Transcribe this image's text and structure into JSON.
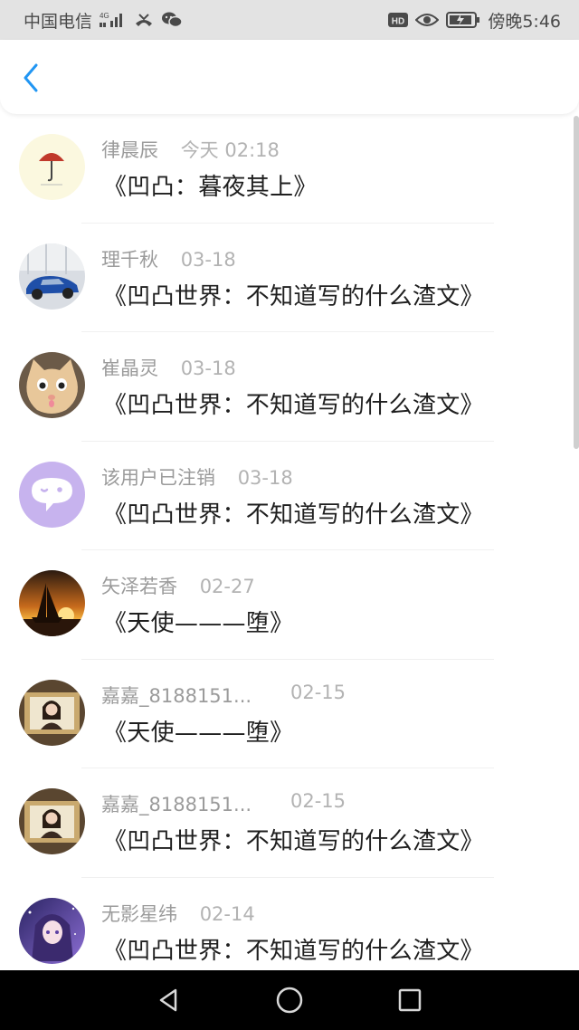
{
  "status_bar": {
    "carrier": "中国电信",
    "signal_label": "4G",
    "hd_label": "HD",
    "time": "傍晚5:46"
  },
  "header": {
    "back_icon": "chevron-left-icon"
  },
  "list": [
    {
      "name": "律晨辰",
      "time": "今天 02:18",
      "title": "《凹凸：暮夜其上》",
      "avatar": "avatar-umbrella"
    },
    {
      "name": "理千秋",
      "time": "03-18",
      "title": "《凹凸世界：不知道写的什么渣文》",
      "avatar": "avatar-car"
    },
    {
      "name": "崔晶灵",
      "time": "03-18",
      "title": "《凹凸世界：不知道写的什么渣文》",
      "avatar": "avatar-cat"
    },
    {
      "name": "该用户已注销",
      "time": "03-18",
      "title": "《凹凸世界：不知道写的什么渣文》",
      "avatar": "avatar-deleted"
    },
    {
      "name": "矢泽若香",
      "time": "02-27",
      "title": "《天使———堕》",
      "avatar": "avatar-sunset"
    },
    {
      "name": "嘉嘉_8188151...",
      "time": "02-15",
      "title": "《天使———堕》",
      "avatar": "avatar-girl-frame"
    },
    {
      "name": "嘉嘉_8188151...",
      "time": "02-15",
      "title": "《凹凸世界：不知道写的什么渣文》",
      "avatar": "avatar-girl-frame"
    },
    {
      "name": "无影星纬",
      "time": "02-14",
      "title": "《凹凸世界：不知道写的什么渣文》",
      "avatar": "avatar-anime-girl"
    }
  ],
  "colors": {
    "accent": "#2196f3",
    "name_text": "#9b9b9b",
    "title_text": "#1f1f1f",
    "status_bar_bg": "#e3e3e3",
    "nav_bar_bg": "#000000"
  },
  "nav_bar": {
    "back": "triangle-back-icon",
    "home": "circle-home-icon",
    "recents": "square-recents-icon"
  }
}
